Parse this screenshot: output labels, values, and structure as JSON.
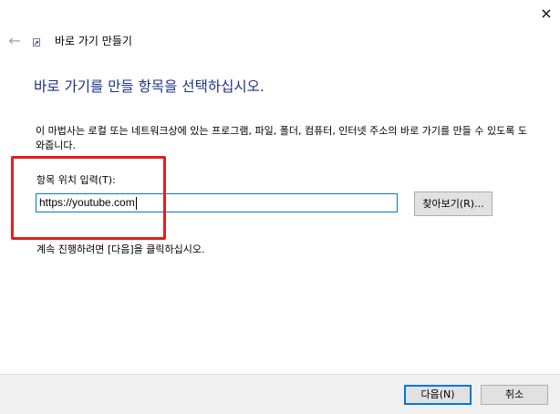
{
  "window": {
    "title": "바로 가기 만들기",
    "close_icon": "×",
    "back_icon": "←"
  },
  "main": {
    "heading": "바로 가기를 만들 항목을 선택하십시오.",
    "description": "이 마법사는 로컬 또는 네트워크상에 있는 프로그램, 파일, 폴더, 컴퓨터, 인터넷 주소의 바로 가기를 만들 수 있도록 도와줍니다.",
    "location_label": "항목 위치 입력(T):",
    "location_value": "https://youtube.com",
    "browse_label": "찾아보기(R)...",
    "continue_text": "계속 진행하려면 [다음]을 클릭하십시오."
  },
  "footer": {
    "next_label": "다음(N)",
    "cancel_label": "취소"
  },
  "colors": {
    "heading": "#1e3287",
    "focus_border": "#0078d7",
    "highlight": "#e02020",
    "footer_bg": "#f0f0f0",
    "button_bg": "#e1e1e1"
  }
}
